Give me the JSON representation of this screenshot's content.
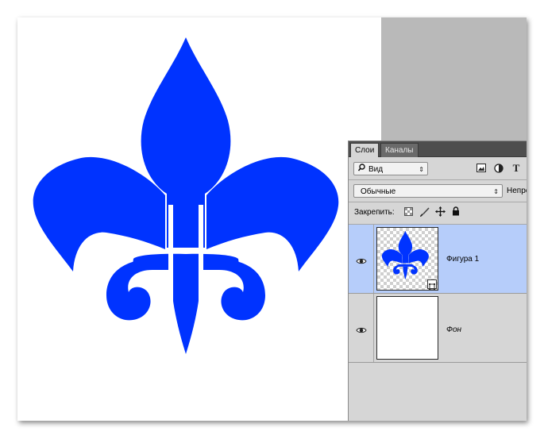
{
  "panel": {
    "tabs": [
      {
        "label": "Слои",
        "active": true
      },
      {
        "label": "Каналы",
        "active": false
      }
    ],
    "filter": {
      "label": "Вид",
      "icon": "search-icon"
    },
    "filter_icons": [
      "image-filter-icon",
      "adjustment-filter-icon",
      "type-filter-icon"
    ],
    "blend_mode": "Обычные",
    "opacity_label": "Непрозрачность",
    "lock_label": "Закрепить:",
    "lock_icons": [
      "lock-transparent-pixels-icon",
      "lock-image-pixels-icon",
      "lock-position-icon",
      "lock-all-icon"
    ],
    "layers": [
      {
        "name": "Фигура 1",
        "visible": true,
        "selected": true,
        "type": "shape"
      },
      {
        "name": "Фон",
        "visible": true,
        "selected": false,
        "type": "background"
      }
    ]
  },
  "colors": {
    "shape_fill": "#0033ff",
    "selected_layer": "#b6cdfa",
    "panel_bg": "#d6d6d6",
    "workspace_bg": "#b9b9b9"
  }
}
